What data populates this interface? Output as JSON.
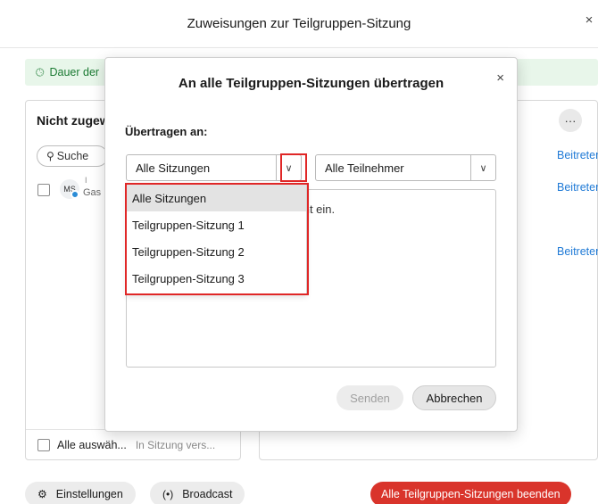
{
  "window": {
    "title": "Zuweisungen zur Teilgruppen-Sitzung",
    "close_glyph": "×"
  },
  "info_bar": {
    "text": "Dauer der"
  },
  "left_panel": {
    "title": "Nicht zugewiesen",
    "search_placeholder": "Suche",
    "participant": {
      "initials": "MS",
      "role_text": "Gas"
    },
    "select_all": "Alle auswäh...",
    "in_session": "In Sitzung vers..."
  },
  "right_panel": {
    "more_glyph": "···",
    "join_links": [
      "Beitreten",
      "Beitreten",
      "Beitreten"
    ]
  },
  "bottom": {
    "settings": "Einstellungen",
    "broadcast": "Broadcast",
    "end_all": "Alle Teilgruppen-Sitzungen beenden"
  },
  "modal": {
    "title": "An alle Teilgruppen-Sitzungen übertragen",
    "close_glyph": "×",
    "label": "Übertragen an:",
    "sessions_select": "Alle Sitzungen",
    "participants_select": "Alle Teilnehmer",
    "message_fragment": "richt ein.",
    "send": "Senden",
    "cancel": "Abbrechen"
  },
  "dropdown": {
    "options": [
      "Alle Sitzungen",
      "Teilgruppen-Sitzung 1",
      "Teilgruppen-Sitzung 2",
      "Teilgruppen-Sitzung 3"
    ],
    "selected": "Alle Sitzungen"
  },
  "colors": {
    "accent_red": "#e02727",
    "end_button": "#d9342b",
    "link_blue": "#1f7ad6",
    "info_green": "#1b7a33"
  }
}
